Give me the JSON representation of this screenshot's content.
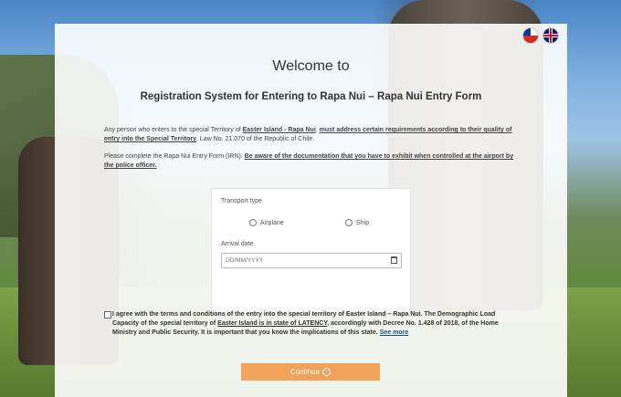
{
  "header": {
    "welcome": "Welcome to",
    "subtitle": "Registration System for Entering to Rapa Nui – Rapa Nui Entry Form"
  },
  "languages": [
    "Spanish (Chile)",
    "English"
  ],
  "intro": {
    "p1_a": "Any person who enters to the special Territory of ",
    "p1_link": "Easter Island - Rapa Nui",
    "p1_b": ", ",
    "p1_bold": "must address certain requirements according to their quality of entry into the Special Territory",
    "p1_c": ", Law No. 21.070 of the Republic of Chile.",
    "p2_a": "Please complete the Rapa Nui Entry Form (IRN). ",
    "p2_bold": "Be aware of the documentation that you have to exhibit when controlled at the airport by the police officer."
  },
  "form": {
    "transport_label": "Transport type",
    "option_airplane": "Airplane",
    "option_ship": "Ship",
    "arrival_label": "Arrival date",
    "date_placeholder": "DD/MM/YYYY"
  },
  "terms": {
    "t1": "I agree with the terms and conditions of the entry into the special territory of Easter Island – Rapa Nui. The Demographic Load Capacity of the special territory of ",
    "t_link": "Easter Island is in state of LATENCY",
    "t2": ", accordingly with Decree No. 1.428 of 2018, of the Home Ministry and Public Security. It is important that you know the implications of this state. ",
    "see_more": "See more"
  },
  "continue_label": "Continue",
  "colors": {
    "button": "#f0a15a",
    "link": "#1a4c9c"
  }
}
